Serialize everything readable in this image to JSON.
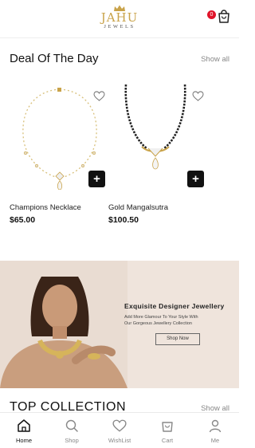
{
  "header": {
    "logo_title": "JAHU",
    "logo_subtitle": "JEWELS",
    "cart_count": "0",
    "icons": {
      "logo": "crown-logo-icon",
      "cart": "cart-icon"
    }
  },
  "deal_section": {
    "title": "Deal Of The Day",
    "show_all": "Show all"
  },
  "products": [
    {
      "name": "Champions Necklace",
      "price": "$65.00",
      "add_label": "+",
      "icon": "heart-icon"
    },
    {
      "name": "Gold Mangalsutra",
      "price": "$100.50",
      "add_label": "+",
      "icon": "heart-icon"
    }
  ],
  "banner": {
    "title": "Exquisite Designer Jewellery",
    "line1": "Add More Glamour To Your Style With",
    "line2": "Our Gorgeous Jewellery Collection",
    "button": "Shop Now",
    "colors": {
      "background": "#efe4dc",
      "gold": "#c9a34a"
    }
  },
  "top_collection": {
    "title": "TOP  COLLECTION",
    "show_all": "Show all"
  },
  "tabbar": {
    "tabs": [
      {
        "label": "Home",
        "icon": "home-icon",
        "active": true
      },
      {
        "label": "Shop",
        "icon": "search-icon",
        "active": false
      },
      {
        "label": "WishList",
        "icon": "heart-icon",
        "active": false
      },
      {
        "label": "Cart",
        "icon": "cart-icon",
        "active": false
      },
      {
        "label": "Me",
        "icon": "user-icon",
        "active": false
      }
    ]
  }
}
